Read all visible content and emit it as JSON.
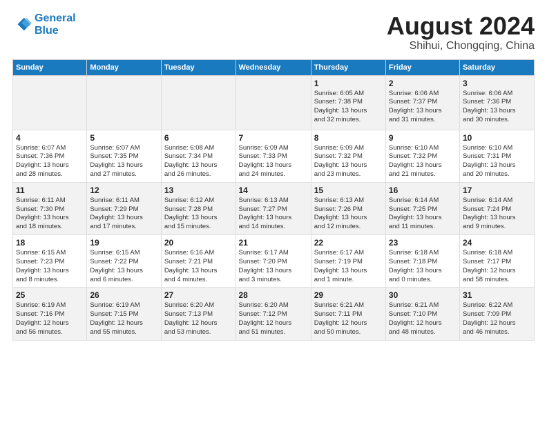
{
  "header": {
    "logo_line1": "General",
    "logo_line2": "Blue",
    "main_title": "August 2024",
    "subtitle": "Shihui, Chongqing, China"
  },
  "weekdays": [
    "Sunday",
    "Monday",
    "Tuesday",
    "Wednesday",
    "Thursday",
    "Friday",
    "Saturday"
  ],
  "weeks": [
    [
      {
        "day": "",
        "info": ""
      },
      {
        "day": "",
        "info": ""
      },
      {
        "day": "",
        "info": ""
      },
      {
        "day": "",
        "info": ""
      },
      {
        "day": "1",
        "info": "Sunrise: 6:05 AM\nSunset: 7:38 PM\nDaylight: 13 hours\nand 32 minutes."
      },
      {
        "day": "2",
        "info": "Sunrise: 6:06 AM\nSunset: 7:37 PM\nDaylight: 13 hours\nand 31 minutes."
      },
      {
        "day": "3",
        "info": "Sunrise: 6:06 AM\nSunset: 7:36 PM\nDaylight: 13 hours\nand 30 minutes."
      }
    ],
    [
      {
        "day": "4",
        "info": "Sunrise: 6:07 AM\nSunset: 7:36 PM\nDaylight: 13 hours\nand 28 minutes."
      },
      {
        "day": "5",
        "info": "Sunrise: 6:07 AM\nSunset: 7:35 PM\nDaylight: 13 hours\nand 27 minutes."
      },
      {
        "day": "6",
        "info": "Sunrise: 6:08 AM\nSunset: 7:34 PM\nDaylight: 13 hours\nand 26 minutes."
      },
      {
        "day": "7",
        "info": "Sunrise: 6:09 AM\nSunset: 7:33 PM\nDaylight: 13 hours\nand 24 minutes."
      },
      {
        "day": "8",
        "info": "Sunrise: 6:09 AM\nSunset: 7:32 PM\nDaylight: 13 hours\nand 23 minutes."
      },
      {
        "day": "9",
        "info": "Sunrise: 6:10 AM\nSunset: 7:32 PM\nDaylight: 13 hours\nand 21 minutes."
      },
      {
        "day": "10",
        "info": "Sunrise: 6:10 AM\nSunset: 7:31 PM\nDaylight: 13 hours\nand 20 minutes."
      }
    ],
    [
      {
        "day": "11",
        "info": "Sunrise: 6:11 AM\nSunset: 7:30 PM\nDaylight: 13 hours\nand 18 minutes."
      },
      {
        "day": "12",
        "info": "Sunrise: 6:11 AM\nSunset: 7:29 PM\nDaylight: 13 hours\nand 17 minutes."
      },
      {
        "day": "13",
        "info": "Sunrise: 6:12 AM\nSunset: 7:28 PM\nDaylight: 13 hours\nand 15 minutes."
      },
      {
        "day": "14",
        "info": "Sunrise: 6:13 AM\nSunset: 7:27 PM\nDaylight: 13 hours\nand 14 minutes."
      },
      {
        "day": "15",
        "info": "Sunrise: 6:13 AM\nSunset: 7:26 PM\nDaylight: 13 hours\nand 12 minutes."
      },
      {
        "day": "16",
        "info": "Sunrise: 6:14 AM\nSunset: 7:25 PM\nDaylight: 13 hours\nand 11 minutes."
      },
      {
        "day": "17",
        "info": "Sunrise: 6:14 AM\nSunset: 7:24 PM\nDaylight: 13 hours\nand 9 minutes."
      }
    ],
    [
      {
        "day": "18",
        "info": "Sunrise: 6:15 AM\nSunset: 7:23 PM\nDaylight: 13 hours\nand 8 minutes."
      },
      {
        "day": "19",
        "info": "Sunrise: 6:15 AM\nSunset: 7:22 PM\nDaylight: 13 hours\nand 6 minutes."
      },
      {
        "day": "20",
        "info": "Sunrise: 6:16 AM\nSunset: 7:21 PM\nDaylight: 13 hours\nand 4 minutes."
      },
      {
        "day": "21",
        "info": "Sunrise: 6:17 AM\nSunset: 7:20 PM\nDaylight: 13 hours\nand 3 minutes."
      },
      {
        "day": "22",
        "info": "Sunrise: 6:17 AM\nSunset: 7:19 PM\nDaylight: 13 hours\nand 1 minute."
      },
      {
        "day": "23",
        "info": "Sunrise: 6:18 AM\nSunset: 7:18 PM\nDaylight: 13 hours\nand 0 minutes."
      },
      {
        "day": "24",
        "info": "Sunrise: 6:18 AM\nSunset: 7:17 PM\nDaylight: 12 hours\nand 58 minutes."
      }
    ],
    [
      {
        "day": "25",
        "info": "Sunrise: 6:19 AM\nSunset: 7:16 PM\nDaylight: 12 hours\nand 56 minutes."
      },
      {
        "day": "26",
        "info": "Sunrise: 6:19 AM\nSunset: 7:15 PM\nDaylight: 12 hours\nand 55 minutes."
      },
      {
        "day": "27",
        "info": "Sunrise: 6:20 AM\nSunset: 7:13 PM\nDaylight: 12 hours\nand 53 minutes."
      },
      {
        "day": "28",
        "info": "Sunrise: 6:20 AM\nSunset: 7:12 PM\nDaylight: 12 hours\nand 51 minutes."
      },
      {
        "day": "29",
        "info": "Sunrise: 6:21 AM\nSunset: 7:11 PM\nDaylight: 12 hours\nand 50 minutes."
      },
      {
        "day": "30",
        "info": "Sunrise: 6:21 AM\nSunset: 7:10 PM\nDaylight: 12 hours\nand 48 minutes."
      },
      {
        "day": "31",
        "info": "Sunrise: 6:22 AM\nSunset: 7:09 PM\nDaylight: 12 hours\nand 46 minutes."
      }
    ]
  ]
}
